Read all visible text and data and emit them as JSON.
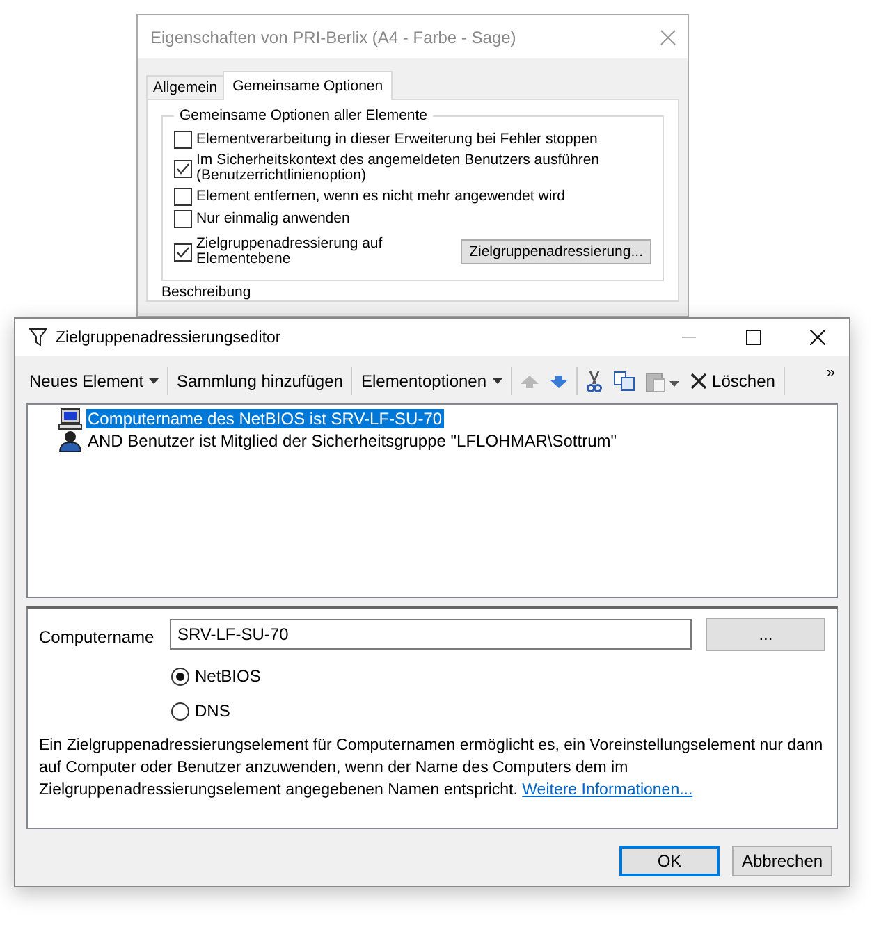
{
  "background_dialog": {
    "title": "Eigenschaften von PRI-Berlix (A4 - Farbe - Sage)",
    "tabs": [
      {
        "label": "Allgemein",
        "selected": false
      },
      {
        "label": "Gemeinsame Optionen",
        "selected": true
      }
    ],
    "group": {
      "legend": "Gemeinsame Optionen aller Elemente",
      "options": [
        {
          "label": "Elementverarbeitung in dieser Erweiterung bei Fehler stoppen",
          "checked": false
        },
        {
          "label": "Im Sicherheitskontext des angemeldeten Benutzers ausführen (Benutzerrichtlinienoption)",
          "checked": true
        },
        {
          "label": "Element entfernen, wenn es nicht mehr angewendet wird",
          "checked": false
        },
        {
          "label": "Nur einmalig anwenden",
          "checked": false
        },
        {
          "label": "Zielgruppenadressierung auf Elementebene",
          "checked": true
        }
      ],
      "button": "Zielgruppenadressierung..."
    },
    "section_label": "Beschreibung"
  },
  "editor": {
    "title": "Zielgruppenadressierungseditor",
    "toolbar": [
      {
        "kind": "dropdown",
        "label": "Neues Element"
      },
      {
        "kind": "separator"
      },
      {
        "kind": "button",
        "label": "Sammlung hinzufügen"
      },
      {
        "kind": "separator"
      },
      {
        "kind": "dropdown",
        "label": "Elementoptionen"
      },
      {
        "kind": "separator"
      },
      {
        "kind": "move-up",
        "disabled": true
      },
      {
        "kind": "move-down",
        "disabled": false
      },
      {
        "kind": "separator"
      },
      {
        "kind": "cut",
        "disabled": false
      },
      {
        "kind": "copy",
        "disabled": false
      },
      {
        "kind": "paste",
        "disabled": true
      },
      {
        "kind": "delete",
        "label": "Löschen"
      },
      {
        "kind": "separator"
      },
      {
        "kind": "overflow",
        "label": "»"
      }
    ],
    "items": [
      {
        "kind": "computer",
        "label": "Computername des NetBIOS ist SRV-LF-SU-70",
        "selected": true
      },
      {
        "kind": "user",
        "label": "AND Benutzer ist Mitglied der Sicherheitsgruppe \"LFLOHMAR\\Sottrum\"",
        "selected": false
      }
    ],
    "form": {
      "label": "Computername",
      "value": "SRV-LF-SU-70",
      "browse_button": "...",
      "radios": [
        {
          "label": "NetBIOS",
          "selected": true
        },
        {
          "label": "DNS",
          "selected": false
        }
      ],
      "description": "Ein Zielgruppenadressierungselement für Computernamen ermöglicht es, ein Voreinstellungselement nur dann auf Computer oder Benutzer anzuwenden, wenn der Name des Computers dem im Zielgruppenadressierungselement angegebenen Namen entspricht.",
      "link": "Weitere Informationen..."
    },
    "buttons": [
      {
        "label": "OK",
        "default": true
      },
      {
        "label": "Abbrechen",
        "default": false
      }
    ]
  }
}
